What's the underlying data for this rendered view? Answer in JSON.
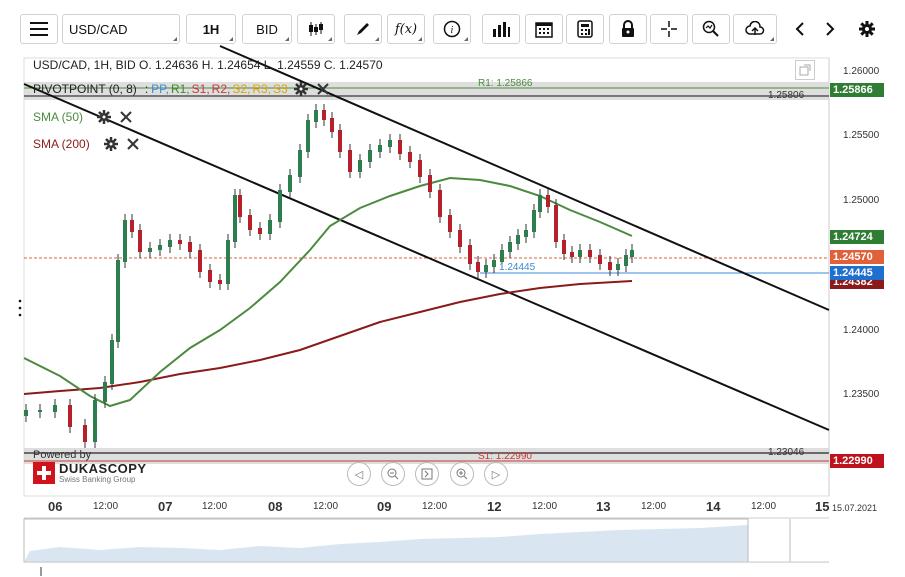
{
  "toolbar": {
    "menu_icon": "hamburger-icon",
    "symbol": "USD/CAD",
    "timeframe": "1H",
    "price_type": "BID",
    "fx_label": "f(x)"
  },
  "header": {
    "ohlc": "USD/CAD, 1H, BID    O. 1.24636 H. 1.24654 L. 1.24559 C. 1.24570"
  },
  "indicators": {
    "pivot": "PIVOTPOINT (0, 8)",
    "pivot_sep": ":",
    "pivot_levels": [
      {
        "label": "PP,",
        "color": "#3b8bd8"
      },
      {
        "label": "R1,",
        "color": "#3a8a2a"
      },
      {
        "label": "S1,",
        "color": "#c43a3a"
      },
      {
        "label": "R2,",
        "color": "#c43a3a"
      },
      {
        "label": "S2,",
        "color": "#e0a400"
      },
      {
        "label": "R3,",
        "color": "#e0a400"
      },
      {
        "label": "S3",
        "color": "#e0a400"
      }
    ],
    "sma50": "SMA (50)",
    "sma200": "SMA (200)"
  },
  "levels": {
    "r1_label": "R1: 1.25866",
    "r1_right": "1.25806",
    "pp_label": "1.24445",
    "s1_label": "S1: 1.22990",
    "s1_right": "1.23046"
  },
  "price_axis": {
    "ticks": [
      "1.26000",
      "1.25500",
      "1.25000",
      "1.24000",
      "1.23500"
    ],
    "labels": [
      {
        "value": "1.25866",
        "color": "#2e7d32"
      },
      {
        "value": "1.24724",
        "color": "#2e7d32"
      },
      {
        "value": "1.24570",
        "color": "#e0603a"
      },
      {
        "value": "1.24445",
        "color": "#1f6fd0"
      },
      {
        "value": "1.24382",
        "color": "#8b1a1a"
      },
      {
        "value": "1.22990",
        "color": "#c0121c"
      }
    ]
  },
  "time_axis": {
    "ticks": [
      {
        "label": "06",
        "day": true
      },
      {
        "label": "12:00",
        "day": false
      },
      {
        "label": "07",
        "day": true
      },
      {
        "label": "12:00",
        "day": false
      },
      {
        "label": "08",
        "day": true
      },
      {
        "label": "12:00",
        "day": false
      },
      {
        "label": "09",
        "day": true
      },
      {
        "label": "12:00",
        "day": false
      },
      {
        "label": "12",
        "day": true
      },
      {
        "label": "12:00",
        "day": false
      },
      {
        "label": "13",
        "day": true
      },
      {
        "label": "12:00",
        "day": false
      },
      {
        "label": "14",
        "day": true
      },
      {
        "label": "12:00",
        "day": false
      },
      {
        "label": "15",
        "day": true
      }
    ],
    "end_date": "15.07.2021"
  },
  "branding": {
    "powered_by": "Powered by",
    "name": "DUKASCOPY",
    "sub": "Swiss Banking Group"
  },
  "colors": {
    "bull": "#2e7d4f",
    "bear": "#b5202a",
    "sma50": "#4c8a3f",
    "sma200": "#8b1a1a",
    "pp": "#3b8bd8"
  }
}
